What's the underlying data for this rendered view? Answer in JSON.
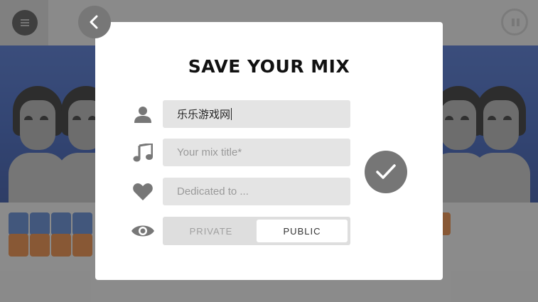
{
  "dialog": {
    "title": "SAVE YOUR MIX",
    "author": {
      "value": "乐乐游戏网",
      "icon": "user-icon"
    },
    "mix_title": {
      "placeholder": "Your mix title*",
      "icon": "music-note-icon"
    },
    "dedication": {
      "placeholder": "Dedicated to ...",
      "icon": "heart-icon"
    },
    "visibility": {
      "icon": "eye-icon",
      "options": [
        "PRIVATE",
        "PUBLIC"
      ],
      "selected": "PUBLIC"
    }
  },
  "buttons": {
    "back": "back-arrow-icon",
    "confirm": "checkmark-icon",
    "menu": "menu-icon",
    "pause": "pause-icon"
  },
  "colors": {
    "dialog_bg": "#ffffff",
    "field_bg": "#e4e4e4",
    "icon_gray": "#777777",
    "stage_blue": "#2f5ac2"
  }
}
